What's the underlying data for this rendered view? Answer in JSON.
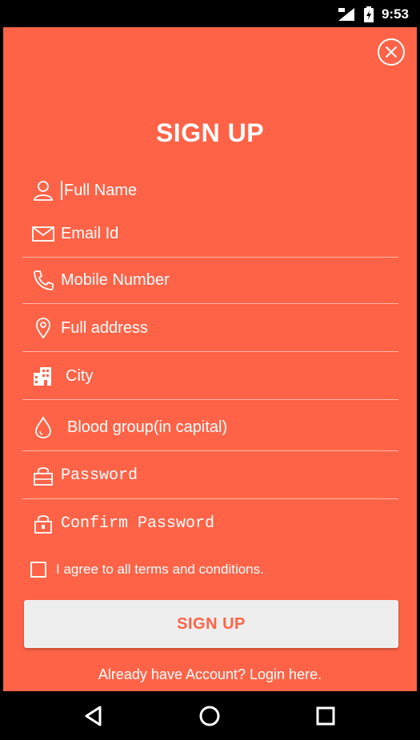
{
  "status_bar": {
    "time": "9:53",
    "signal_icon": "signal-icon",
    "battery_icon": "battery-icon"
  },
  "header": {
    "title": "SIGN UP",
    "close_icon": "close-circle-icon"
  },
  "form": {
    "fields": [
      {
        "label": "Full Name",
        "icon": "person-icon"
      },
      {
        "label": "Email Id",
        "icon": "mail-icon"
      },
      {
        "label": "Mobile Number",
        "icon": "phone-icon"
      },
      {
        "label": "Full address",
        "icon": "location-pin-icon"
      },
      {
        "label": "City",
        "icon": "building-icon"
      },
      {
        "label": "Blood group(in capital)",
        "icon": "drop-icon"
      },
      {
        "label": "Password",
        "icon": "lock-icon"
      },
      {
        "label": "Confirm Password",
        "icon": "lock-icon"
      }
    ],
    "agree_text": "I agree to all terms and conditions.",
    "submit_label": "SIGN UP",
    "login_link": "Already have Account? Login here."
  },
  "colors": {
    "background": "#FF6347",
    "button_bg": "#EEEEEE",
    "button_text": "#FF6347"
  },
  "nav_bar": {
    "icons": [
      "back-icon",
      "home-icon",
      "recents-icon"
    ]
  }
}
